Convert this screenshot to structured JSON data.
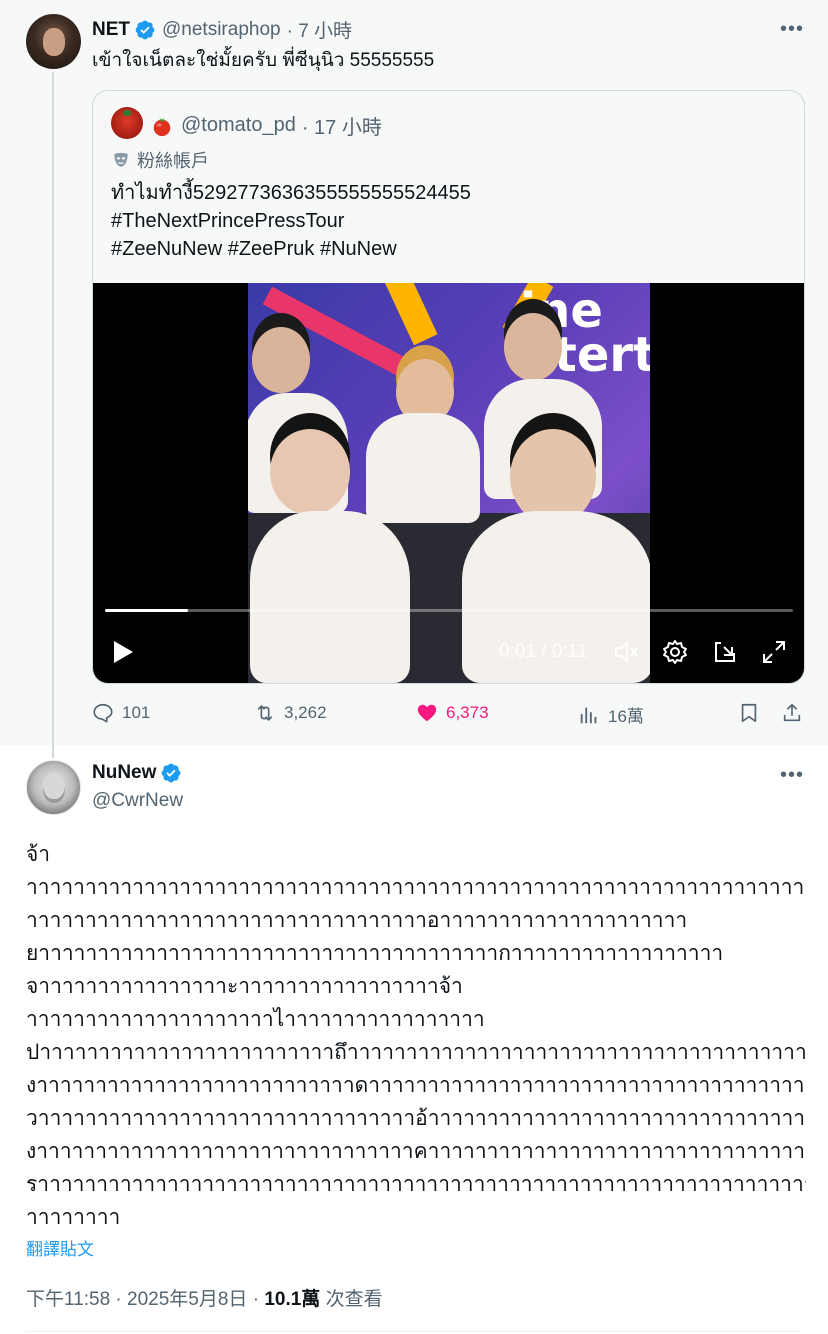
{
  "net_tweet": {
    "name": "NET",
    "handle": "@netsiraphop",
    "time": "· 7 小時",
    "text": "เข้าใจเน็ตละใช่มั้ยครับ พี่ซีนุนิว 55555555",
    "more_icon": "more-dots-icon",
    "quote": {
      "handle": "@tomato_pd",
      "time": "· 17 小時",
      "label": "粉絲帳戶",
      "label_icon": "mask-icon",
      "lines": [
        "ทำไมทำงี้5292773636355555555524455",
        "#TheNextPrincePressTour",
        "#ZeeNuNew #ZeePruk #NuNew"
      ],
      "video": {
        "progress_fraction": 0.12,
        "time_readout": "0:01 / 0:11",
        "brand_text": "ine\nntert"
      }
    },
    "actions": {
      "reply": "101",
      "retweet": "3,262",
      "like": "6,373",
      "views": "16萬"
    }
  },
  "nunew_tweet": {
    "name": "NuNew",
    "handle": "@CwrNew",
    "body_lines": [
      "จ้า",
      "าาาาาาาาาาาาาาาาาาาาาาาาาาาาาาาาาาาาาาาาาาาาาาาาาาาาาาาาาาาาาาาาาาา",
      "าาาาาาาาาาาาาาาาาาาาาาาาาาาาาาาาาาอาาาาาาาาาาาาาาาาาาาาา",
      "ยาาาาาาาาาาาาาาาาาาาาาาาาาาาาาาาาาาาาาาากาาาาาาาาาาาาาาาาาา",
      "จาาาาาาาาาาาาาาาาะาาาาาาาาาาาาาาาาาจ้า",
      "าาาาาาาาาาาาาาาาาาาาาไาาาาาาาาาาาาาาาาา",
      "ปาาาาาาาาาาาาาาาาาาาาาาาาาถึาาาาาาาาาาาาาาาาาาาาาาาาาาาาาาาาาาาาาาาาาาาา",
      "งาาาาาาาาาาาาาาาาาาาาาาาาาาาดาาาาาาาาาาาาาาาาาาาาาาาาาาาาาาาาาาาาาา",
      "วาาาาาาาาาาาาาาาาาาาาาาาาาาาาาาาาอ้าาาาาาาาาาาาาาาาาาาาาาาาาาาาาาาาาาาาาาาาาาา",
      "งาาาาาาาาาาาาาาาาาาาาาาาาาาาาาาาาคาาาาาาาาาาาาาาาาาาาาาาาาาาาาาาาา",
      "ราาาาาาาาาาาาาาาาาาาาาาาาาาาาาาาาาาาาาาาาาาาาาาาาาาาาาาาาาาาาาาาาาาาาาาาาา",
      "าาาาาาาา"
    ],
    "translate": "翻譯貼文",
    "timestamp": "下午11:58 · 2025年5月8日 · ",
    "views_count": "10.1萬",
    "views_suffix": " 次查看"
  },
  "colors": {
    "accent": "#1d9bf0",
    "like": "#f91880",
    "muted": "#536471",
    "text": "#0f1419"
  }
}
